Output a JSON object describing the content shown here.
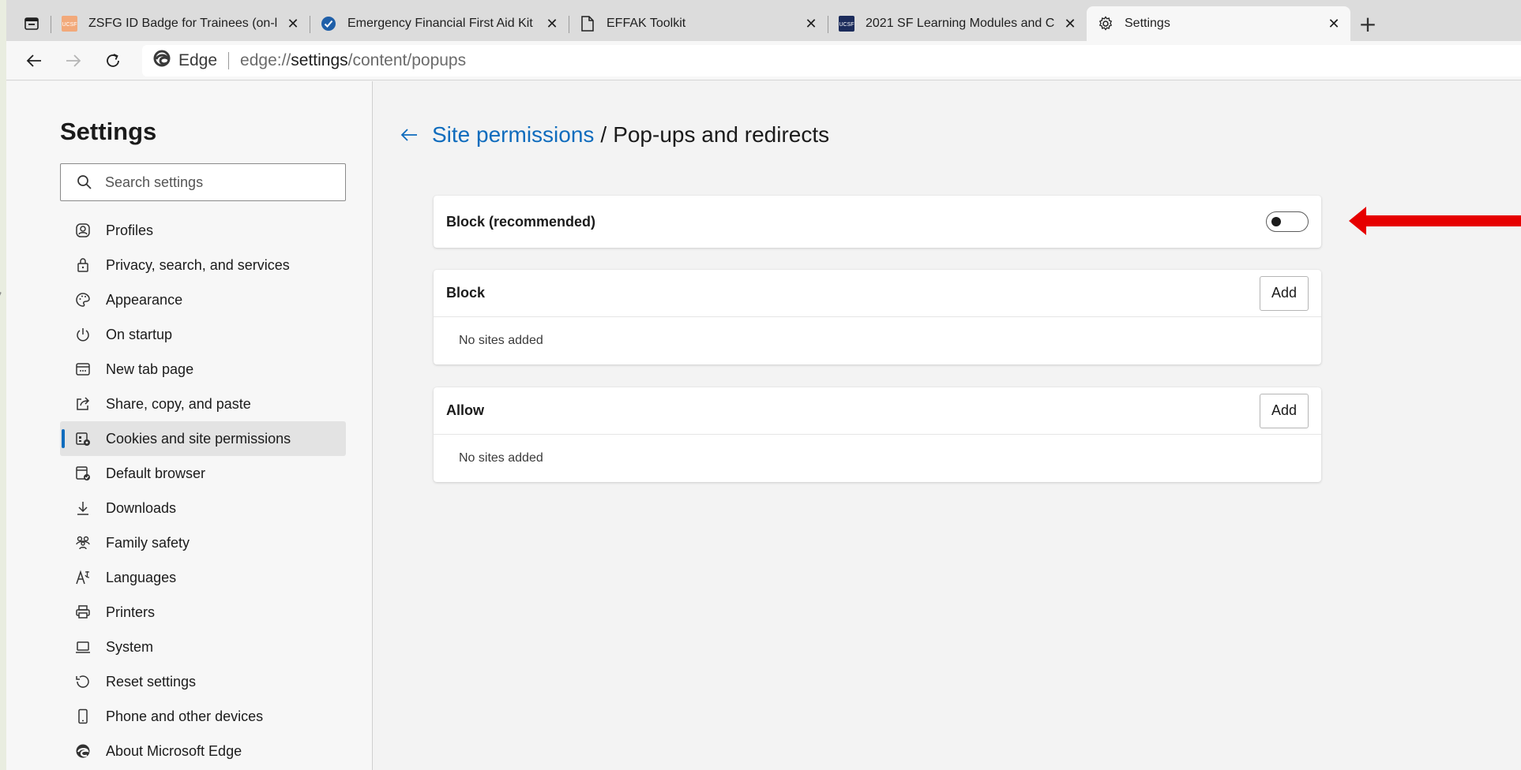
{
  "tabs": [
    {
      "title": "ZSFG ID Badge for Trainees (on-l",
      "favicon": "ucsf-logo-icon",
      "favicon_color": "#f2a97a",
      "active": false
    },
    {
      "title": "Emergency Financial First Aid Kit",
      "favicon": "checkmark-circle-icon",
      "favicon_color": "#1f5fa8",
      "active": false
    },
    {
      "title": "EFFAK Toolkit",
      "favicon": "document-icon",
      "active": false
    },
    {
      "title": "2021 SF Learning Modules and C",
      "favicon": "ucsf-logo-icon",
      "favicon_color": "#1c2c5b",
      "active": false
    },
    {
      "title": "Settings",
      "favicon": "gear-icon",
      "active": true
    }
  ],
  "toolbar": {
    "edge_label": "Edge",
    "url_scheme": "edge://",
    "url_host": "settings",
    "url_path": "/content/popups"
  },
  "sidebar": {
    "title": "Settings",
    "search_placeholder": "Search settings",
    "items": [
      {
        "label": "Profiles",
        "icon": "profile-icon"
      },
      {
        "label": "Privacy, search, and services",
        "icon": "lock-icon"
      },
      {
        "label": "Appearance",
        "icon": "palette-icon"
      },
      {
        "label": "On startup",
        "icon": "power-icon"
      },
      {
        "label": "New tab page",
        "icon": "new-tab-icon"
      },
      {
        "label": "Share, copy, and paste",
        "icon": "share-icon"
      },
      {
        "label": "Cookies and site permissions",
        "icon": "cookies-icon",
        "selected": true
      },
      {
        "label": "Default browser",
        "icon": "default-browser-icon"
      },
      {
        "label": "Downloads",
        "icon": "download-icon"
      },
      {
        "label": "Family safety",
        "icon": "family-icon"
      },
      {
        "label": "Languages",
        "icon": "languages-icon"
      },
      {
        "label": "Printers",
        "icon": "printer-icon"
      },
      {
        "label": "System",
        "icon": "laptop-icon"
      },
      {
        "label": "Reset settings",
        "icon": "reset-icon"
      },
      {
        "label": "Phone and other devices",
        "icon": "phone-icon"
      },
      {
        "label": "About Microsoft Edge",
        "icon": "edge-logo-icon"
      }
    ]
  },
  "main": {
    "breadcrumb_link": "Site permissions",
    "breadcrumb_sep": "/",
    "breadcrumb_current": "Pop-ups and redirects",
    "block_recommended": {
      "label": "Block (recommended)",
      "toggle_on": false
    },
    "block_list": {
      "label": "Block",
      "add_label": "Add",
      "empty_text": "No sites added"
    },
    "allow_list": {
      "label": "Allow",
      "add_label": "Add",
      "empty_text": "No sites added"
    }
  },
  "colors": {
    "accent": "#0f6cbd",
    "annotation_arrow": "#e60000"
  }
}
